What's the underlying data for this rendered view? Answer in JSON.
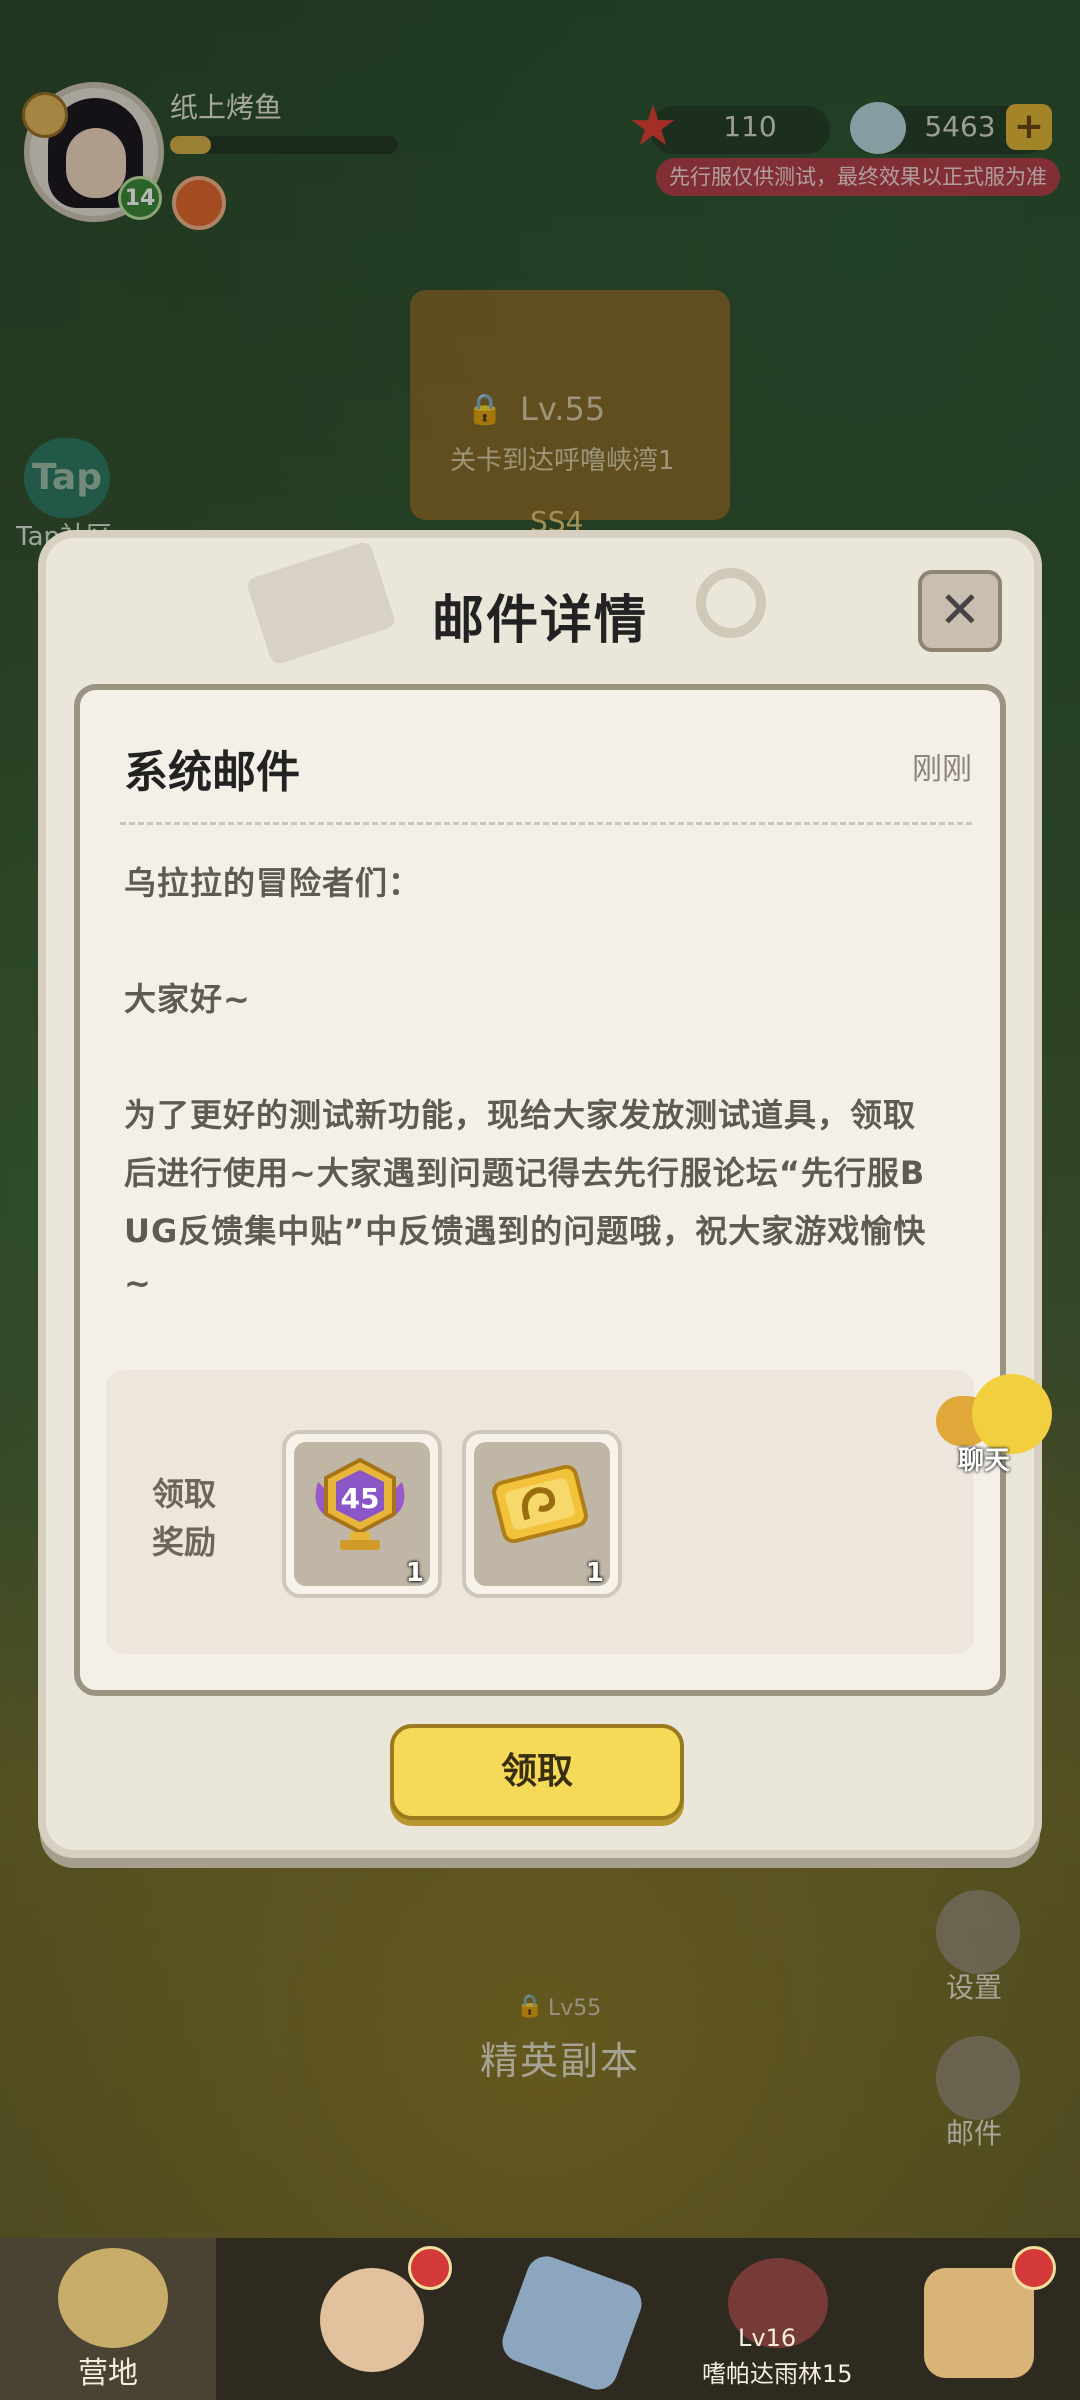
{
  "hud": {
    "username": "纸上烤鱼",
    "level": "14",
    "xp_progress": 0.18,
    "resource_starfish": "110",
    "resource_shell": "5463",
    "notice": "先行服仅供测试，最终效果以正式服为准"
  },
  "scene": {
    "banner_level": "Lv.55",
    "banner_subtitle": "关卡到达呼噜峡湾1",
    "banner_tag": "SS4",
    "tap_label": "Tap社区",
    "elite_level": "Lv55",
    "elite_title": "精英副本",
    "side_settings": "设置",
    "side_mail": "邮件"
  },
  "dialog": {
    "title": "邮件详情",
    "mail": {
      "title": "系统邮件",
      "time": "刚刚",
      "greeting": "乌拉拉的冒险者们：",
      "hello": "大家好~",
      "body_lines": [
        "为了更好的测试新功能，现给大家发放测试道具，领取",
        "后进行使用~大家遇到问题记得去先行服论坛“先行服B",
        "UG反馈集中贴”中反馈遇到的问题哦，祝大家游戏愉快",
        "~"
      ]
    },
    "rewards": {
      "label_line1": "领取",
      "label_line2": "奖励",
      "items": [
        {
          "icon": "trophy-45-icon",
          "badge": "45",
          "count": "1"
        },
        {
          "icon": "ticket-icon",
          "count": "1"
        }
      ]
    },
    "claim_label": "领取"
  },
  "chat": {
    "label": "聊天"
  },
  "nav": {
    "tabs": [
      {
        "label": "营地",
        "active": true
      },
      {
        "label": "",
        "active": false
      },
      {
        "label": "",
        "active": false
      },
      {
        "label": "嗜帕达雨林15",
        "level": "Lv16",
        "locked": true
      },
      {
        "label": "",
        "active": false
      }
    ]
  },
  "colors": {
    "accent": "#f5da5a",
    "notice_bg": "#b5404a",
    "panel_border": "#9b9483"
  }
}
